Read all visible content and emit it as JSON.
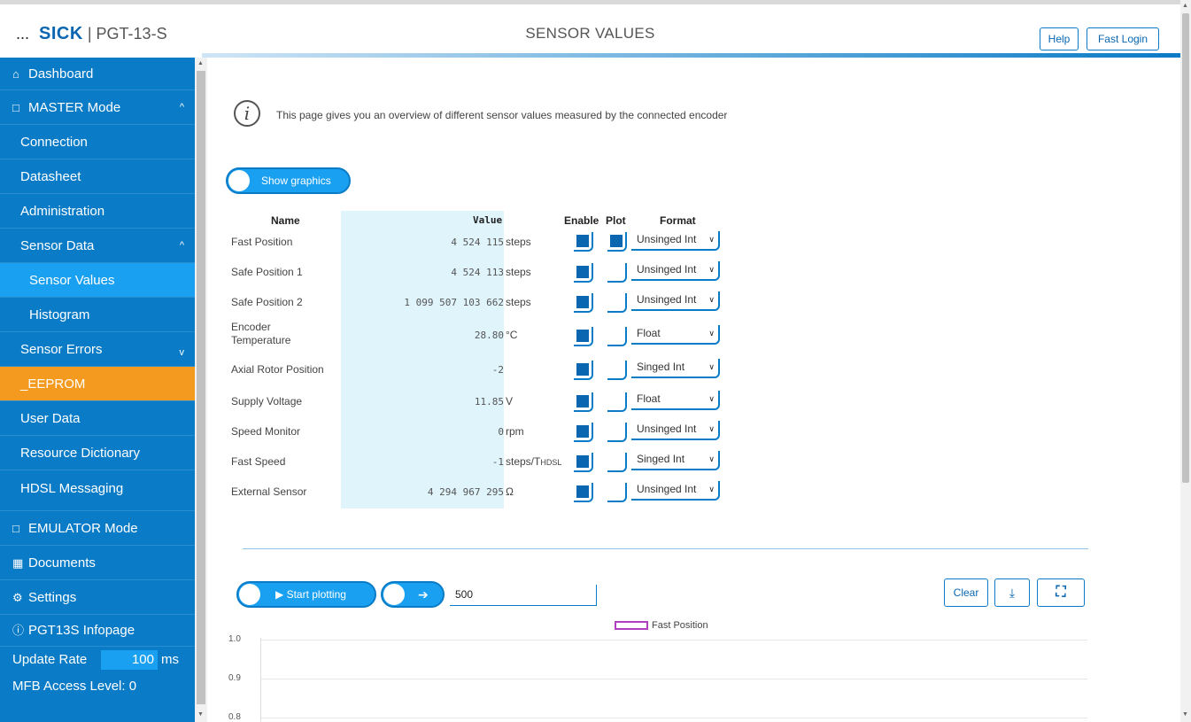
{
  "header": {
    "menu_dots": "...",
    "brand": "SICK",
    "separator": "|",
    "model": "PGT-13-S",
    "page_title": "SENSOR VALUES",
    "help_label": "Help",
    "fast_login_label": "Fast Login"
  },
  "sidebar": {
    "items": [
      {
        "label": "Dashboard",
        "icon": "home-icon"
      },
      {
        "label": "MASTER Mode",
        "icon": "monitor-icon",
        "chevron": "^"
      },
      {
        "label": "Connection"
      },
      {
        "label": "Datasheet"
      },
      {
        "label": "Administration"
      },
      {
        "label": "Sensor Data",
        "chevron": "^"
      },
      {
        "label": "Sensor Values"
      },
      {
        "label": "Histogram"
      },
      {
        "label": "Sensor Errors",
        "chevron": "v"
      },
      {
        "label": "_EEPROM"
      },
      {
        "label": "User Data"
      },
      {
        "label": "Resource Dictionary"
      },
      {
        "label": "HDSL Messaging"
      },
      {
        "label": "EMULATOR Mode",
        "icon": "monitor-icon"
      },
      {
        "label": "Documents",
        "icon": "document-icon"
      },
      {
        "label": "Settings",
        "icon": "gears-icon"
      },
      {
        "label": "PGT13S Infopage",
        "icon": "info-circle-icon"
      }
    ],
    "update_rate_label": "Update Rate",
    "update_rate_value": "100",
    "update_rate_unit": "ms",
    "access_level": "MFB Access Level: 0"
  },
  "main": {
    "info_text": "This page gives you an overview of different sensor values measured by the connected encoder",
    "show_graphics_label": "Show graphics",
    "columns": {
      "name": "Name",
      "value": "Value",
      "enable": "Enable",
      "plot": "Plot",
      "format": "Format"
    },
    "rows": [
      {
        "name": "Fast Position",
        "value": "4 524 115",
        "unit": "steps",
        "enable": true,
        "plot": true,
        "format": "Unsinged Int"
      },
      {
        "name": "Safe Position 1",
        "value": "4 524 113",
        "unit": "steps",
        "enable": true,
        "plot": false,
        "format": "Unsinged Int"
      },
      {
        "name": "Safe Position 2",
        "value": "1 099 507 103 662",
        "unit": "steps",
        "enable": true,
        "plot": false,
        "format": "Unsinged Int"
      },
      {
        "name": "Encoder Temperature",
        "value": "28.80",
        "unit": "°C",
        "enable": true,
        "plot": false,
        "format": "Float"
      },
      {
        "name": "Axial Rotor Position",
        "value": "-2",
        "unit": "",
        "enable": true,
        "plot": false,
        "format": "Singed Int"
      },
      {
        "name": "Supply Voltage",
        "value": "11.85",
        "unit": "V",
        "enable": true,
        "plot": false,
        "format": "Float"
      },
      {
        "name": "Speed Monitor",
        "value": "0",
        "unit": "rpm",
        "enable": true,
        "plot": false,
        "format": "Unsinged Int"
      },
      {
        "name": "Fast Speed",
        "value": "-1",
        "unit": "steps/T",
        "unit_sub": "HDSL",
        "enable": true,
        "plot": false,
        "format": "Singed Int"
      },
      {
        "name": "External Sensor",
        "value": "4 294 967 295",
        "unit": "Ω",
        "enable": true,
        "plot": false,
        "format": "Unsinged Int"
      }
    ]
  },
  "plot": {
    "start_label": "Start plotting",
    "samples_value": "500",
    "clear_label": "Clear",
    "legend": "Fast Position",
    "legend_color": "#b040c0",
    "y_ticks": [
      "1.0",
      "0.9",
      "0.8"
    ]
  },
  "colors": {
    "sidebar": "#0a7bc6",
    "active": "#1aa0f0",
    "eeprom": "#f39a1f"
  }
}
